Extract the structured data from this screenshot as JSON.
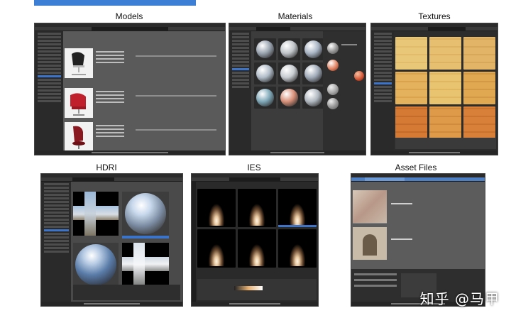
{
  "captions": {
    "models": "Models",
    "materials": "Materials",
    "textures": "Textures",
    "hdri": "HDRI",
    "ies": "IES",
    "asset_files": "Asset Files"
  },
  "watermark": "知乎 @马甲",
  "colors": {
    "accent_bar": "#3d7fd4",
    "app_background": "#1e1e1e",
    "selection": "#3b74c9"
  },
  "icons": {
    "chair": "chair-render",
    "material_ball": "material-preview-sphere",
    "wood": "wood-texture-swatch",
    "hdri_sphere": "chrome-ball",
    "ies_light": "ies-light-cone",
    "arch_photo": "architecture-photo"
  }
}
